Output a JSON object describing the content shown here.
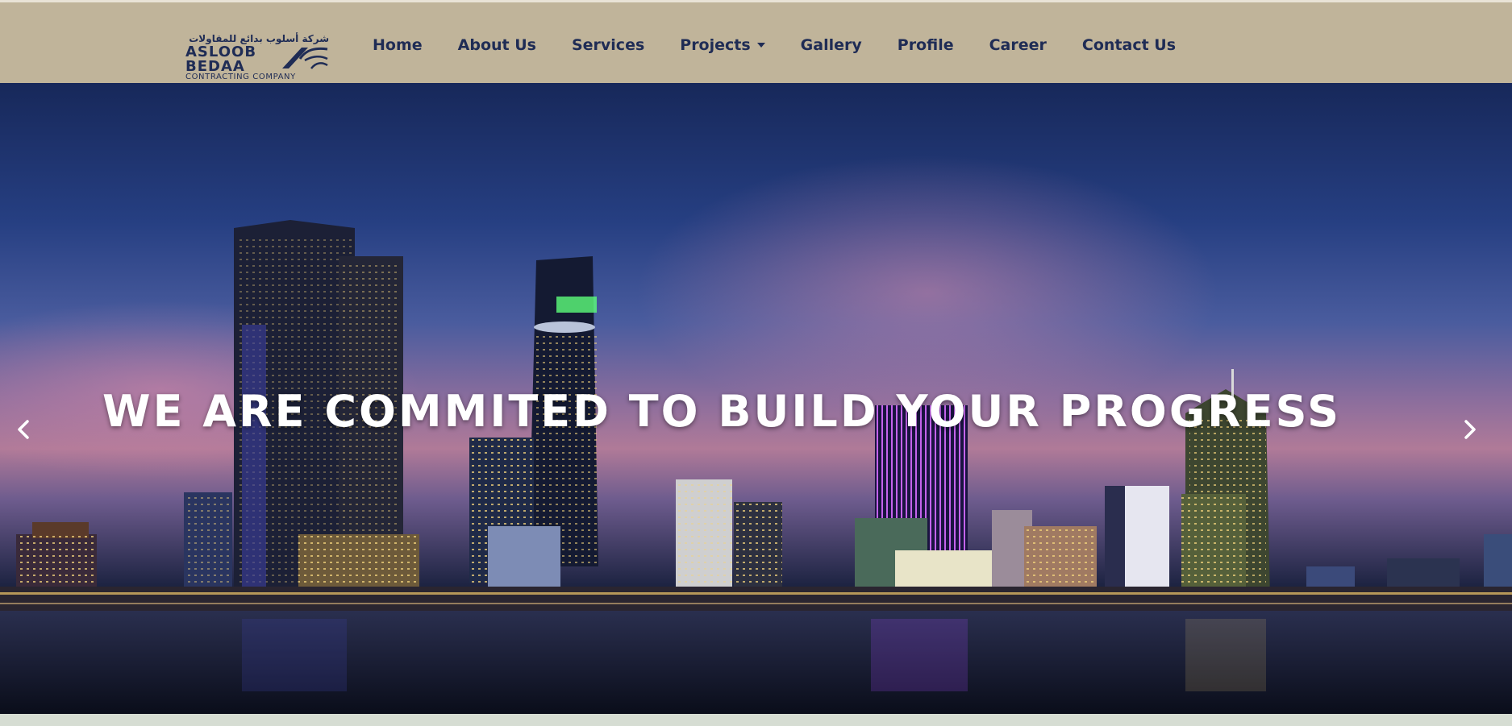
{
  "logo": {
    "arabic": "شركة أسلوب بدائع للمقاولات",
    "line1": "ASLOOB",
    "line2": "BEDAA",
    "tagline": "CONTRACTING COMPANY"
  },
  "nav": {
    "items": [
      {
        "label": "Home"
      },
      {
        "label": "About Us"
      },
      {
        "label": "Services"
      },
      {
        "label": "Projects",
        "dropdown": true
      },
      {
        "label": "Gallery"
      },
      {
        "label": "Profile"
      },
      {
        "label": "Career"
      },
      {
        "label": "Contact Us"
      }
    ]
  },
  "hero": {
    "title": "WE ARE COMMITED TO BUILD YOUR PROGRESS",
    "prev_icon": "chevron-left-icon",
    "next_icon": "chevron-right-icon"
  },
  "colors": {
    "header_bg": "#c0b49a",
    "nav_text": "#1f2c55",
    "hero_text": "#ffffff",
    "bottom_band": "#d6ddd3"
  }
}
